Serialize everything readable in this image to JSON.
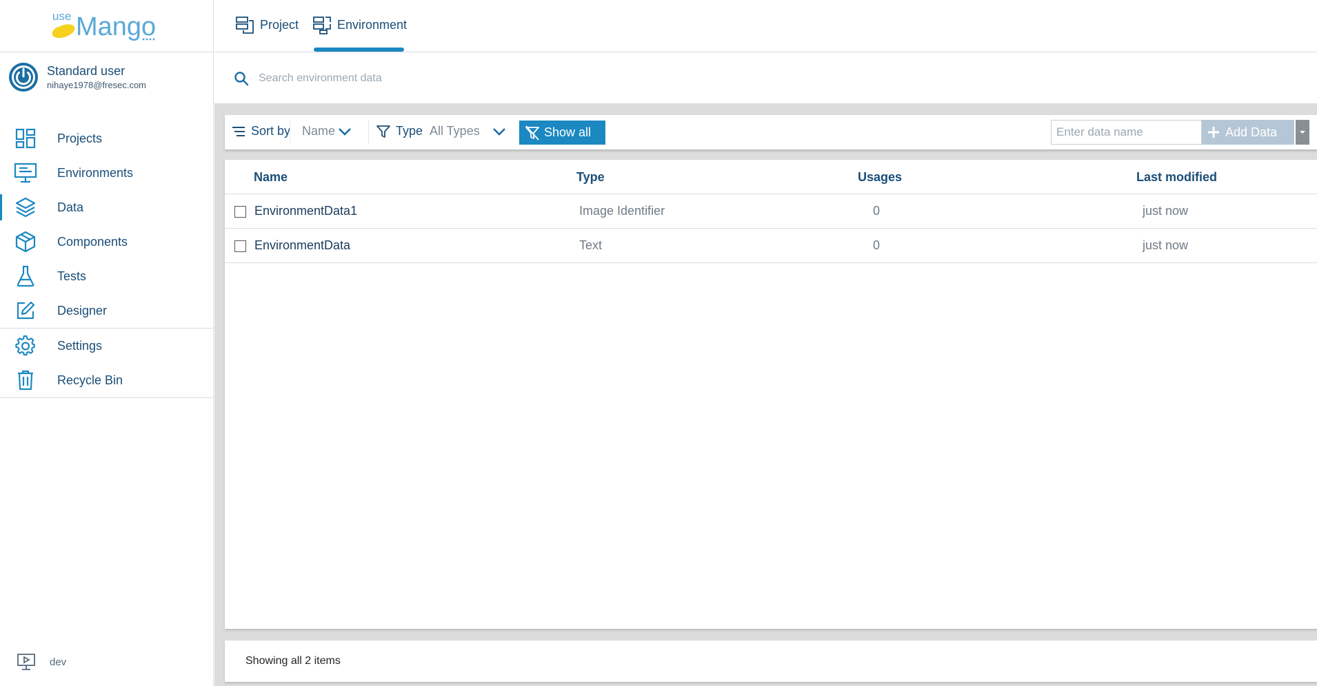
{
  "brand": {
    "logo_prefix": "use",
    "logo_name": "Mango",
    "accent": "#1b88c1",
    "logo_yellow": "#f5d11e"
  },
  "user": {
    "name": "Standard user",
    "email": "nihaye1978@fresec.com",
    "avatar_icon": "power-icon"
  },
  "sidebar": {
    "items": [
      {
        "label": "Projects",
        "icon": "projects-grid-icon"
      },
      {
        "label": "Environments",
        "icon": "monitor-icon"
      },
      {
        "label": "Data",
        "icon": "layers-icon",
        "active": true
      },
      {
        "label": "Components",
        "icon": "cube-icon"
      },
      {
        "label": "Tests",
        "icon": "flask-icon"
      },
      {
        "label": "Designer",
        "icon": "edit-icon"
      },
      {
        "label": "Settings",
        "icon": "gear-icon"
      },
      {
        "label": "Recycle Bin",
        "icon": "trash-icon"
      }
    ],
    "footer": {
      "label": "dev",
      "icon": "play-monitor-icon"
    }
  },
  "tabs": [
    {
      "label": "Project",
      "icon": "project-db-icon"
    },
    {
      "label": "Environment",
      "icon": "environment-db-icon",
      "active": true
    }
  ],
  "search": {
    "placeholder": "Search environment data",
    "icon": "search-icon"
  },
  "toolbar": {
    "sort_label": "Sort by",
    "sort_value": "Name",
    "type_label": "Type",
    "type_value": "All Types",
    "show_all_label": "Show all",
    "name_input_placeholder": "Enter data name",
    "add_data_label": "Add Data"
  },
  "table": {
    "columns": [
      "Name",
      "Type",
      "Usages",
      "Last modified"
    ],
    "rows": [
      {
        "name": "EnvironmentData1",
        "type": "Image Identifier",
        "usages": "0",
        "last_modified": "just now"
      },
      {
        "name": "EnvironmentData",
        "type": "Text",
        "usages": "0",
        "last_modified": "just now"
      }
    ]
  },
  "status": {
    "text": "Showing all 2 items"
  }
}
